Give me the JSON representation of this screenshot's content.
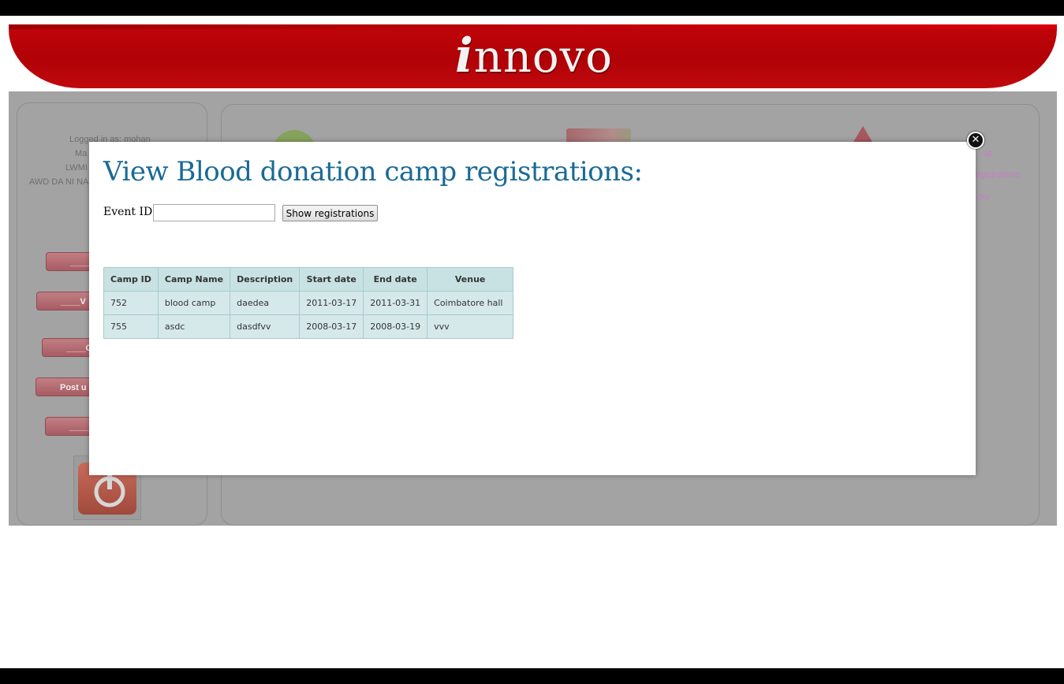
{
  "brand": {
    "logo_initial": "i",
    "logo_rest": "nnovo"
  },
  "background": {
    "logged_in": "Logged in as: mohan",
    "line2": "Ma",
    "line3": "LWMI",
    "line4": "AWD DA NI NA",
    "link1": "ap",
    "link2": "egistrations",
    "link3": "cks",
    "buttons": [
      "____",
      "____V",
      "____C",
      "Post u",
      "____"
    ]
  },
  "modal": {
    "title": "View Blood donation camp registrations:",
    "event_label": "Event ID:",
    "event_value": "",
    "show_button": "Show registrations",
    "close_glyph": "✕"
  },
  "table": {
    "headers": [
      "Camp ID",
      "Camp Name",
      "Description",
      "Start date",
      "End date",
      "Venue"
    ],
    "rows": [
      [
        "752",
        "blood camp",
        "daedea",
        "2011-03-17",
        "2011-03-31",
        "Coimbatore hall"
      ],
      [
        "755",
        "asdc",
        "dasdfvv",
        "2008-03-17",
        "2008-03-19",
        "vvv"
      ]
    ]
  }
}
